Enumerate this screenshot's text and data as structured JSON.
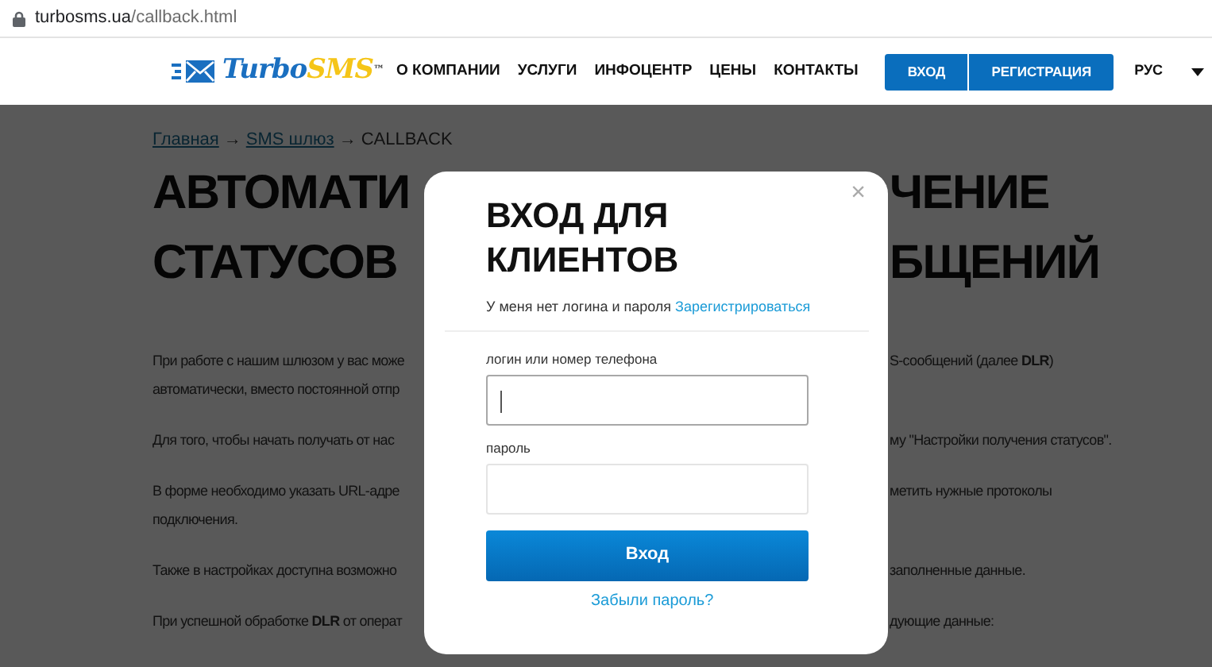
{
  "address_bar": {
    "domain": "turbosms.ua",
    "path": "/callback.html"
  },
  "logo": {
    "part_1": "Turbo",
    "part_2": "SMS",
    "mark": "™"
  },
  "nav": [
    "О КОМПАНИИ",
    "УСЛУГИ",
    "ИНФОЦЕНТР",
    "ЦЕНЫ",
    "КОНТАКТЫ"
  ],
  "auth_buttons": [
    "ВХОД",
    "РЕГИСТРАЦИЯ"
  ],
  "language": "РУС",
  "breadcrumb": [
    {
      "label": "Главная",
      "kind": "link"
    },
    {
      "label": "→",
      "kind": "separator"
    },
    {
      "label": "SMS шлюз",
      "kind": "link"
    },
    {
      "label": "→",
      "kind": "separator"
    },
    {
      "label": "CALLBACK",
      "kind": "current"
    }
  ],
  "heading_lines": [
    {
      "left": "АВТОМАТИ",
      "right": "ЧЕНИЕ"
    },
    {
      "left": "СТАТУСОВ",
      "right": "БЩЕНИЙ"
    }
  ],
  "paragraphs": [
    {
      "lines": [
        {
          "left": "При работе с нашим шлюзом у вас може",
          "right": "S-сообщений (далее **DLR**)"
        },
        {
          "left": "автоматически, вместо постоянной отпр"
        }
      ]
    },
    {
      "lines": [
        {
          "left": "Для того, чтобы начать получать от нас",
          "right": "му \"Настройки получения статусов\"."
        }
      ]
    },
    {
      "lines": [
        {
          "left": "В форме необходимо указать URL-адре",
          "right": "метить нужные протоколы"
        },
        {
          "left": "подключения."
        }
      ]
    },
    {
      "lines": [
        {
          "left": "Также в настройках доступна возможно",
          "right": "заполненные данные."
        }
      ]
    },
    {
      "lines": [
        {
          "left": "При успешной обработке **DLR** от операт",
          "right": "дующие данные:"
        }
      ]
    }
  ],
  "modal": {
    "close": "×",
    "title": "ВХОД ДЛЯ КЛИЕНТОВ",
    "no_account_text": "У меня нет логина и пароля",
    "register_link": "Зарегистрироваться",
    "fields": [
      {
        "label": "логин или номер телефона",
        "focused": true
      },
      {
        "label": "пароль",
        "focused": false
      }
    ],
    "submit": "Вход",
    "forgot_link": "Забыли пароль?"
  }
}
